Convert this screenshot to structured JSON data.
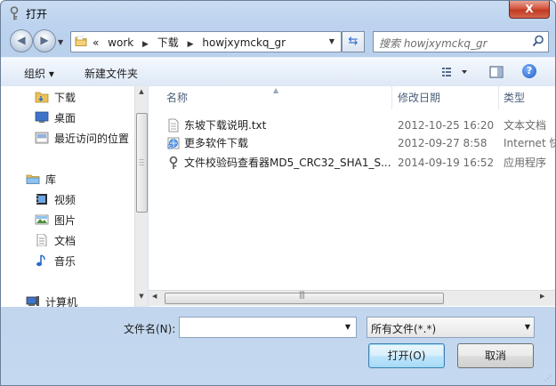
{
  "window": {
    "title": "打开",
    "close_label": "X"
  },
  "nav": {
    "breadcrumb": {
      "overflow": "«",
      "items": [
        "work",
        "下载",
        "howjxymckq_gr"
      ]
    },
    "search_placeholder": "搜索 howjxymckq_gr"
  },
  "toolbar": {
    "organize": "组织 ▾",
    "new_folder": "新建文件夹",
    "help": "?"
  },
  "sidebar": {
    "items": [
      {
        "label": "下载",
        "icon": "folder-icon"
      },
      {
        "label": "桌面",
        "icon": "desktop-icon"
      },
      {
        "label": "最近访问的位置",
        "icon": "recent-places-icon"
      },
      {
        "label": "库",
        "icon": "library-icon"
      },
      {
        "label": "视频",
        "icon": "video-icon"
      },
      {
        "label": "图片",
        "icon": "picture-icon"
      },
      {
        "label": "文档",
        "icon": "document-icon"
      },
      {
        "label": "音乐",
        "icon": "music-icon"
      },
      {
        "label": "计算机",
        "icon": "computer-icon"
      }
    ]
  },
  "files": {
    "columns": [
      "名称",
      "修改日期",
      "类型"
    ],
    "rows": [
      {
        "name": "东坡下载说明.txt",
        "date": "2012-10-25 16:20",
        "type": "文本文档",
        "icon": "text-file-icon"
      },
      {
        "name": "更多软件下载",
        "date": "2012-09-27 8:58",
        "type": "Internet 快捷方式",
        "icon": "internet-shortcut-icon"
      },
      {
        "name": "文件校验码查看器MD5_CRC32_SHA1_S...",
        "date": "2014-09-19 16:52",
        "type": "应用程序",
        "icon": "application-icon"
      }
    ]
  },
  "footer": {
    "filename_label": "文件名(N):",
    "filename_value": "",
    "filetype_value": "所有文件(*.*)",
    "open_button": "打开(O)",
    "cancel_button": "取消"
  },
  "colors": {
    "window_frame": "#bcd2ee",
    "close_button": "#c23a22",
    "accent": "#3c7fb1"
  }
}
